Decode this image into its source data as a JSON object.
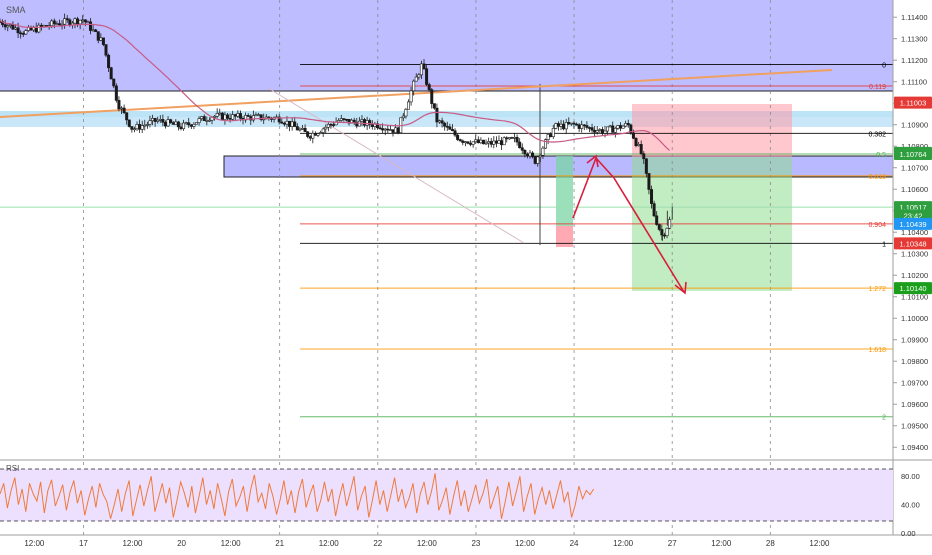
{
  "chart": {
    "symbol_label": "SMA",
    "rsi_label": "RSI"
  },
  "chart_data": {
    "type": "candlestick",
    "price_axis": {
      "ticks": [
        1.114,
        1.113,
        1.112,
        1.111,
        1.11,
        1.109,
        1.108,
        1.107,
        1.106,
        1.105,
        1.104,
        1.103,
        1.102,
        1.101,
        1.1,
        1.099,
        1.098,
        1.097,
        1.096,
        1.095,
        1.094
      ],
      "tick_labels": [
        "1.11400",
        "1.11300",
        "1.11200",
        "1.11100",
        "1.11000",
        "1.10900",
        "1.10800",
        "1.10700",
        "1.10600",
        "1.10500",
        "1.10400",
        "1.10300",
        "1.10200",
        "1.10100",
        "1.10000",
        "1.09900",
        "1.09800",
        "1.09700",
        "1.09600",
        "1.09500",
        "1.09400"
      ],
      "range": [
        1.0935,
        1.1148
      ]
    },
    "time_axis": {
      "labels": [
        "12:00",
        "17",
        "12:00",
        "20",
        "12:00",
        "21",
        "12:00",
        "22",
        "12:00",
        "23",
        "12:00",
        "24",
        "12:00",
        "27",
        "12:00",
        "28",
        "12:00"
      ],
      "range_days": [
        -0.85,
        8.25
      ]
    },
    "price_badges": [
      {
        "text": "1.11003",
        "value": 1.11003,
        "color": "#e53935"
      },
      {
        "text": "1.10769",
        "value": 1.10769,
        "color": "#2e9e3e"
      },
      {
        "text": "1.10764",
        "value": 1.10764,
        "color": "#2e9e3e"
      },
      {
        "text": "1.10517",
        "value": 1.10517,
        "color": "#2e9e3e"
      },
      {
        "text": "23:42",
        "value": 1.10478,
        "color": "#2e9e3e"
      },
      {
        "text": "1.10439",
        "value": 1.10439,
        "color": "#2196f3"
      },
      {
        "text": "1.10348",
        "value": 1.10348,
        "color": "#e53935"
      },
      {
        "text": "1.10140",
        "value": 1.1014,
        "color": "#1b9e1b"
      }
    ],
    "fibonacci": {
      "levels": [
        {
          "label": "0",
          "price": 1.1118,
          "color": "#000000"
        },
        {
          "label": "0.119",
          "price": 1.1108,
          "color": "#e53935"
        },
        {
          "label": "0.382",
          "price": 1.1086,
          "color": "#000000"
        },
        {
          "label": "0.5",
          "price": 1.10764,
          "color": "#4caf50"
        },
        {
          "label": "0.618",
          "price": 1.10662,
          "color": "#ff9800"
        },
        {
          "label": "0.904",
          "price": 1.10439,
          "color": "#e53935"
        },
        {
          "label": "1",
          "price": 1.10348,
          "color": "#000000"
        },
        {
          "label": "1.272",
          "price": 1.1014,
          "color": "#ff9800"
        },
        {
          "label": "1.618",
          "price": 1.09857,
          "color": "#ff9800"
        },
        {
          "label": "2",
          "price": 1.09542,
          "color": "#4caf50"
        }
      ]
    },
    "rsi": {
      "axis_ticks": [
        80,
        40,
        0
      ],
      "tick_labels": [
        "80.00",
        "40.00",
        "0.00"
      ],
      "upper_band": 70,
      "lower_band": 30,
      "values": [
        55,
        70,
        35,
        60,
        78,
        40,
        62,
        30,
        70,
        55,
        45,
        72,
        28,
        60,
        75,
        38,
        52,
        68,
        32,
        58,
        74,
        42,
        60,
        25,
        48,
        66,
        36,
        70,
        54,
        44,
        20,
        40,
        62,
        30,
        56,
        74,
        24,
        46,
        68,
        38,
        60,
        80,
        30,
        50,
        70,
        42,
        64,
        22,
        46,
        72,
        56,
        36,
        66,
        28,
        52,
        78,
        40,
        60,
        34,
        70,
        48,
        24,
        58,
        76,
        38,
        50,
        66,
        30,
        62,
        82,
        44,
        56,
        34,
        70,
        52,
        26,
        48,
        74,
        40,
        60,
        28,
        58,
        76,
        36,
        54,
        68,
        30,
        46,
        72,
        44,
        62,
        24,
        50,
        70,
        38,
        58,
        80,
        32,
        52,
        66,
        22,
        46,
        74,
        40,
        60,
        30,
        54,
        78,
        44,
        62,
        36,
        50,
        70,
        28,
        56,
        72,
        40,
        58,
        84,
        32,
        46,
        64,
        26,
        52,
        74,
        38,
        60,
        30,
        48,
        68,
        42,
        56,
        76,
        34,
        50,
        66,
        20,
        44,
        72,
        38,
        58,
        80,
        30,
        52,
        70,
        26,
        48,
        64,
        40,
        60,
        34,
        54,
        74,
        44,
        58,
        22,
        40,
        66,
        48,
        60,
        54,
        62
      ]
    }
  }
}
